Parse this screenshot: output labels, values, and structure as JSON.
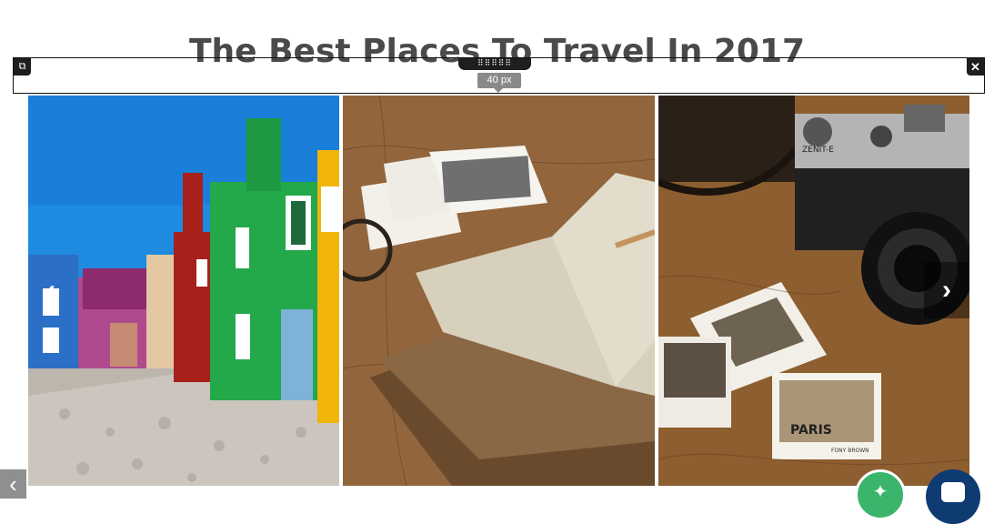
{
  "page": {
    "title": "The Best Places To Travel In 2017"
  },
  "spacer": {
    "height_tooltip": "40 px",
    "drag_handle_label": "⠿⠿⠿⠿⠿",
    "left_icon": "duplicate-icon",
    "right_icon": "close-icon",
    "close_glyph": "✕",
    "duplicate_glyph": "⧉"
  },
  "gallery": {
    "images": [
      {
        "name": "colorful-houses-street",
        "alt": ""
      },
      {
        "name": "notebook-and-photos-on-map",
        "alt": ""
      },
      {
        "name": "vintage-camera-and-polaroids",
        "alt": ""
      }
    ],
    "prev_glyph": "‹",
    "next_glyph": "›",
    "polaroid_texts": [
      "PARIS",
      "FONY BROWN",
      "ZENIT-E"
    ]
  },
  "controls": {
    "edge_prev_glyph": "‹",
    "magic_icon": "magic-wand-icon",
    "chat_icon": "chat-icon"
  },
  "colors": {
    "title": "#4a4a4a",
    "fab_green": "#3bb56b",
    "fab_chat": "#0f3b73"
  }
}
